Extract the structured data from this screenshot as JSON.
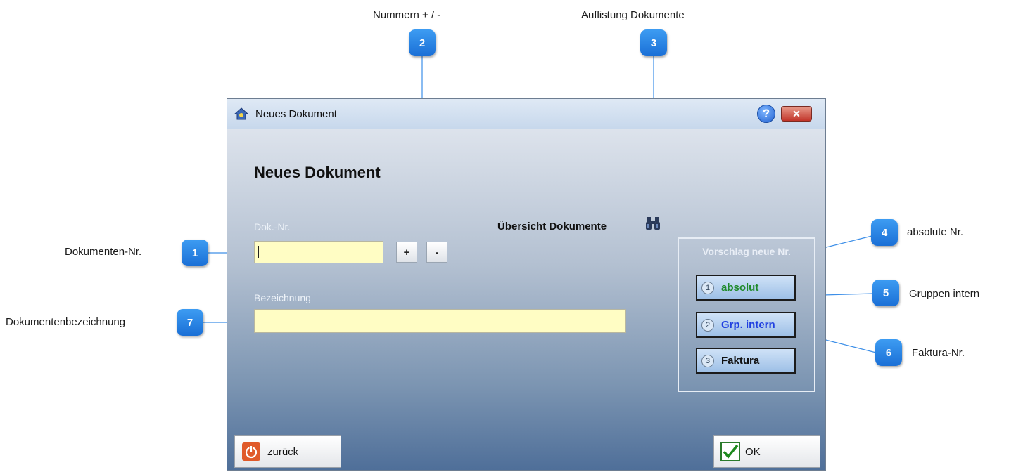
{
  "annotations": {
    "top": [
      {
        "number": "2",
        "text": "Nummern + / -"
      },
      {
        "number": "3",
        "text": "Auflistung Dokumente"
      }
    ],
    "left": [
      {
        "number": "1",
        "text": "Dokumenten-Nr."
      },
      {
        "number": "7",
        "text": "Dokumentenbezeichnung"
      }
    ],
    "right": [
      {
        "number": "4",
        "text": "absolute Nr."
      },
      {
        "number": "5",
        "text": "Gruppen intern"
      },
      {
        "number": "6",
        "text": "Faktura-Nr."
      }
    ]
  },
  "window": {
    "title": "Neues Dokument",
    "help_icon": "?",
    "close_icon": "✕",
    "heading": "Neues Dokument"
  },
  "form": {
    "doknr_label": "Dok.-Nr.",
    "doknr_value": "",
    "plus_label": "+",
    "minus_label": "-",
    "bezeichnung_label": "Bezeichnung",
    "bezeichnung_value": "",
    "overview_label": "Übersicht Dokumente",
    "overview_icon": "binoculars-icon"
  },
  "vorschlag": {
    "title": "Vorschlag neue Nr.",
    "buttons": [
      {
        "num": "1",
        "label": "absolut",
        "color": "#1f8a2a"
      },
      {
        "num": "2",
        "label": "Grp. intern",
        "color": "#1f3fe0"
      },
      {
        "num": "3",
        "label": "Faktura",
        "color": "#111111"
      }
    ]
  },
  "footer": {
    "back_label": "zurück",
    "ok_label": "OK"
  }
}
